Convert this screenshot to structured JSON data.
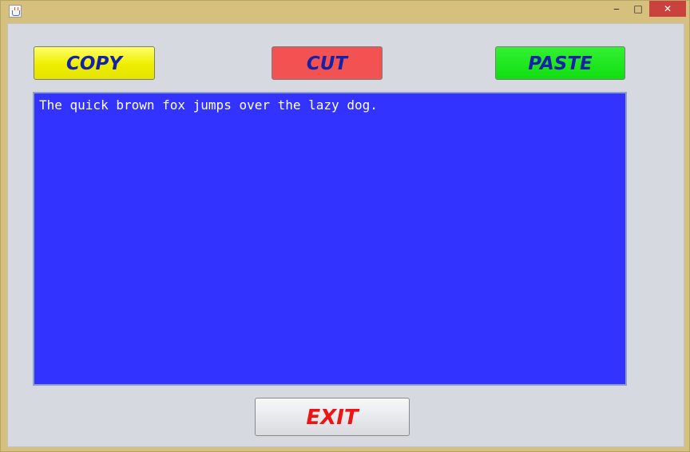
{
  "titlebar": {
    "minimize_glyph": "‒",
    "maximize_glyph": "□",
    "close_glyph": "✕"
  },
  "toolbar": {
    "copy_label": "COPY",
    "cut_label": "CUT",
    "paste_label": "PASTE"
  },
  "editor": {
    "text": "The quick brown fox jumps over the lazy dog."
  },
  "footer": {
    "exit_label": "EXIT"
  },
  "colors": {
    "copy_button": "#ffff00",
    "cut_button": "#f25252",
    "paste_button": "#10df10",
    "text_area_background": "#3333ff",
    "button_text": "#1522a8",
    "exit_text": "#f01313",
    "window_frame": "#d5c17d"
  }
}
